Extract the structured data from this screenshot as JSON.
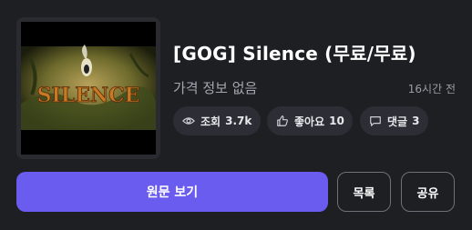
{
  "post": {
    "title": "[GOG] Silence (무료/무료)",
    "price": "가격 정보 없음",
    "time_ago": "16시간 전",
    "thumbnail_text": "SILENCE"
  },
  "stats": {
    "views_label": "조회",
    "views_value": "3.7k",
    "likes_label": "좋아요",
    "likes_value": "10",
    "comments_label": "댓글",
    "comments_value": "3"
  },
  "actions": {
    "view_original": "원문 보기",
    "list": "목록",
    "share": "공유"
  },
  "icons": {
    "views": "eye-icon",
    "likes": "thumbs-up-icon",
    "comments": "comment-icon"
  },
  "colors": {
    "background": "#1e1f23",
    "accent": "#6b5cf0",
    "chip": "#2d2e35"
  }
}
